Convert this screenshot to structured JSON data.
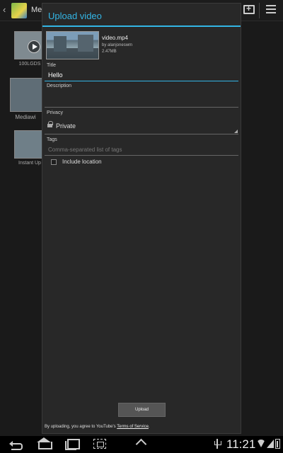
{
  "background": {
    "title": "Me",
    "albums": [
      {
        "caption": "100LGDS"
      },
      {
        "caption": "Mediawi"
      },
      {
        "caption": "Instant Up"
      }
    ]
  },
  "dialog": {
    "title": "Upload video",
    "file": {
      "name": "video.mp4",
      "user": "by alanjoneswm",
      "size": "2.47MB"
    },
    "title_label": "Title",
    "title_value": "Hello",
    "description_label": "Description",
    "description_value": "",
    "privacy_label": "Privacy",
    "privacy_value": "Private",
    "tags_label": "Tags",
    "tags_placeholder": "Comma-separated list of tags",
    "include_location_label": "Include location",
    "include_location_checked": false,
    "upload_label": "Upload",
    "tos_prefix": "By uploading, you agree to YouTube's ",
    "tos_link": "Terms of Service",
    "tos_suffix": "."
  },
  "status_bar": {
    "time": "11:21"
  },
  "colors": {
    "accent": "#33b5e5",
    "dialog_bg": "#282828"
  }
}
